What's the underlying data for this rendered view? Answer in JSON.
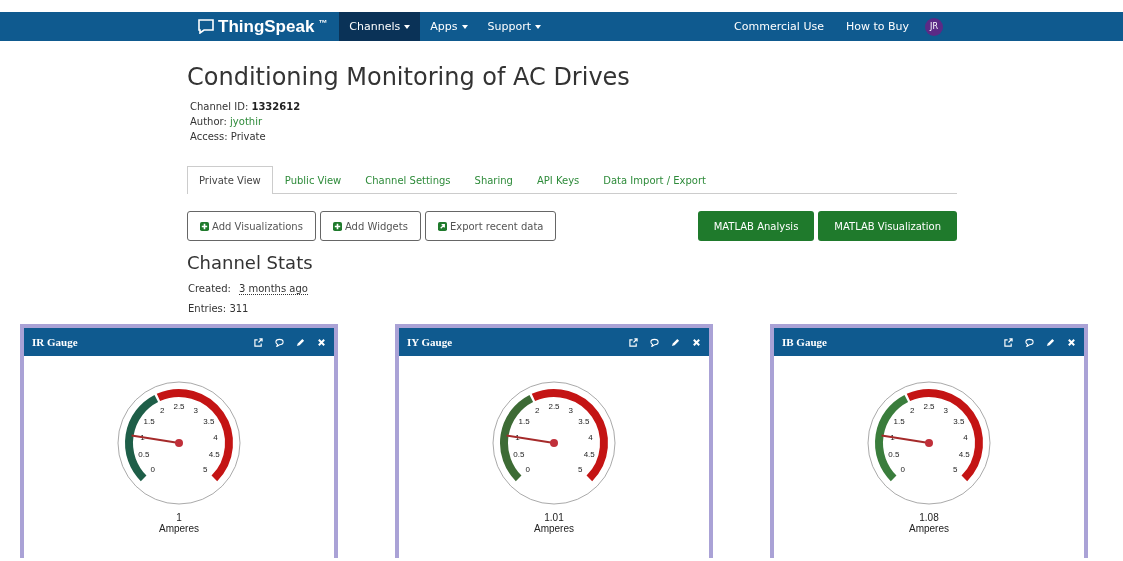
{
  "navbar": {
    "logo": "ThingSpeak",
    "trademark": "™",
    "menu": [
      {
        "label": "Channels",
        "dropdown": true,
        "selected": true
      },
      {
        "label": "Apps",
        "dropdown": true,
        "selected": false
      },
      {
        "label": "Support",
        "dropdown": true,
        "selected": false
      }
    ],
    "right_links": [
      "Commercial Use",
      "How to Buy"
    ],
    "avatar": "JR"
  },
  "title": "Conditioning Monitoring of AC Drives",
  "meta": [
    {
      "label": "Channel ID:",
      "value": "1332612",
      "kind": "bold"
    },
    {
      "label": "Author:",
      "value": "jyothir",
      "kind": "link"
    },
    {
      "label": "Access:",
      "value": "Private",
      "kind": "plain"
    }
  ],
  "tabs": [
    {
      "label": "Private View",
      "selected": true
    },
    {
      "label": "Public View",
      "selected": false
    },
    {
      "label": "Channel Settings",
      "selected": false
    },
    {
      "label": "Sharing",
      "selected": false
    },
    {
      "label": "API Keys",
      "selected": false
    },
    {
      "label": "Data Import / Export",
      "selected": false
    }
  ],
  "actions": [
    {
      "label": "Add Visualizations",
      "kind": "add"
    },
    {
      "label": "Add Widgets",
      "kind": "add"
    },
    {
      "label": "Export recent data",
      "kind": "export"
    }
  ],
  "matlab_buttons": [
    "MATLAB Analysis",
    "MATLAB Visualization"
  ],
  "stats": {
    "heading": "Channel Stats",
    "created_label": "Created:",
    "created_value": "3 months ago",
    "entries": "Entries: 311"
  },
  "gauges": [
    {
      "title": "IR Gauge",
      "ticks": [
        "0",
        "0.5",
        "1",
        "1.5",
        "2",
        "2.5",
        "3",
        "3.5",
        "4",
        "4.5",
        "5"
      ],
      "value": "1",
      "unit": "Amperes",
      "bands": [
        {
          "color": "#1e5e48"
        },
        {
          "color": "#c41414"
        }
      ]
    },
    {
      "title": "IY Gauge",
      "ticks": [
        "0",
        "0.5",
        "1",
        "1.5",
        "2",
        "2.5",
        "3",
        "3.5",
        "4",
        "4.5",
        "5"
      ],
      "value": "1.01",
      "unit": "Amperes",
      "bands": [
        {
          "color": "#3d6b35"
        },
        {
          "color": "#c41414"
        }
      ]
    },
    {
      "title": "IB Gauge",
      "ticks": [
        "0",
        "0.5",
        "1",
        "1.5",
        "2",
        "2.5",
        "3",
        "3.5",
        "4",
        "4.5",
        "5"
      ],
      "value": "1.08",
      "unit": "Amperes",
      "bands": [
        {
          "color": "#3a7d3c"
        },
        {
          "color": "#c41414"
        }
      ]
    }
  ]
}
